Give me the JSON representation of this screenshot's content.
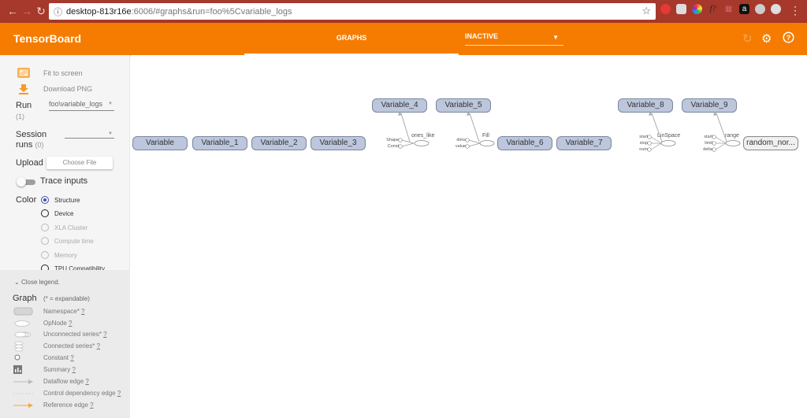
{
  "browser": {
    "url_host": "desktop-813r16e",
    "url_rest": ":6006/#graphs&run=foo%5Cvariable_logs",
    "back_icon": "arrow-left-icon",
    "forward_icon": "arrow-right-icon",
    "reload_icon": "reload-icon",
    "info_icon": "info-icon",
    "star_icon": "star-icon"
  },
  "header": {
    "title": "TensorBoard",
    "tab": "GRAPHS",
    "dropdown_value": "INACTIVE",
    "accent": "#f57c00"
  },
  "sidebar": {
    "fit_to_screen": "Fit to screen",
    "download_png": "Download PNG",
    "run_label": "Run",
    "run_count": "(1)",
    "run_value": "foo\\variable_logs",
    "session_label": "Session",
    "session_label2": "runs",
    "session_count": "(0)",
    "upload_label": "Upload",
    "choose_file": "Choose File",
    "trace_inputs": "Trace inputs",
    "color_label": "Color",
    "color_options": [
      {
        "label": "Structure",
        "selected": true
      },
      {
        "label": "Device",
        "selected": false
      },
      {
        "label": "XLA Cluster",
        "selected": false
      },
      {
        "label": "Compute time",
        "selected": false
      },
      {
        "label": "Memory",
        "selected": false
      },
      {
        "label": "TPU Compatibility",
        "selected": false
      }
    ]
  },
  "legend": {
    "close": "Close legend.",
    "graph": "Graph",
    "expandable": "(* = expandable)",
    "items": [
      {
        "label": "Namespace*",
        "q": "?"
      },
      {
        "label": "OpNode",
        "q": "?"
      },
      {
        "label": "Unconnected series*",
        "q": "?"
      },
      {
        "label": "Connected series*",
        "q": "?"
      },
      {
        "label": "Constant",
        "q": "?"
      },
      {
        "label": "Summary",
        "q": "?"
      },
      {
        "label": "Dataflow edge",
        "q": "?"
      },
      {
        "label": "Control dependency edge",
        "q": "?"
      },
      {
        "label": "Reference edge",
        "q": "?"
      }
    ]
  },
  "graph": {
    "row_nodes": [
      "Variable",
      "Variable_1",
      "Variable_2",
      "Variable_3",
      "Variable_6",
      "Variable_7"
    ],
    "top_nodes": [
      "Variable_4",
      "Variable_5",
      "Variable_8",
      "Variable_9"
    ],
    "ops": [
      {
        "name": "ones_like",
        "inputs": [
          "Shape",
          "Const"
        ]
      },
      {
        "name": "Fill",
        "inputs": [
          "dims",
          "value"
        ]
      },
      {
        "name": "LinSpace",
        "inputs": [
          "start",
          "stop",
          "num"
        ]
      },
      {
        "name": "range",
        "inputs": [
          "start",
          "limit",
          "delta"
        ]
      }
    ],
    "random_node": "random_nor..."
  }
}
